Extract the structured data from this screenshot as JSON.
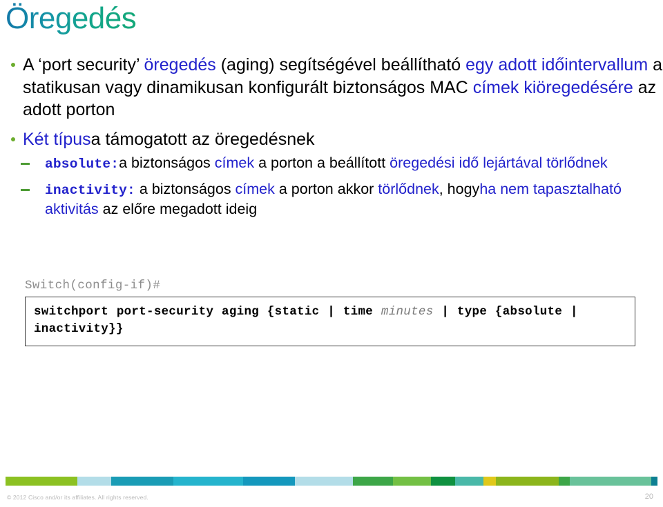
{
  "slide": {
    "title": "Öregedés",
    "page_number": "20",
    "title_gradient_from": "#1277a8",
    "title_gradient_to": "#14a878",
    "accent_blue": "#2222cc",
    "bullet_green": "#6cad2e",
    "dash_green": "#4e9c35"
  },
  "bullets": [
    {
      "level": 1,
      "runs": [
        {
          "text": "A ‘port security’ ",
          "style": "black"
        },
        {
          "text": "öregedés",
          "style": "blue"
        },
        {
          "text": " (aging) segítségével beállítható ",
          "style": "black"
        },
        {
          "text": "egy adott időintervallum",
          "style": "blue"
        },
        {
          "text": " a statikusan vagy dinamikusan konfigurált biztonságos MAC ",
          "style": "black"
        },
        {
          "text": "címek kiöregedésére",
          "style": "blue"
        },
        {
          "text": " az adott porton",
          "style": "black"
        }
      ]
    },
    {
      "level": 1,
      "runs": [
        {
          "text": "Két típus",
          "style": "blue"
        },
        {
          "text": "a támogatott az öregedésnek",
          "style": "black"
        }
      ]
    },
    {
      "level": 2,
      "runs": [
        {
          "text": "absolute:",
          "style": "mono"
        },
        {
          "text": "a biztonságos ",
          "style": "black"
        },
        {
          "text": "címek",
          "style": "blue"
        },
        {
          "text": " a porton a beállított ",
          "style": "black"
        },
        {
          "text": "öregedési idő lejártával törlődnek",
          "style": "blue"
        }
      ]
    },
    {
      "level": 2,
      "runs": [
        {
          "text": "inactivity:",
          "style": "mono"
        },
        {
          "text": " a biztonságos ",
          "style": "black"
        },
        {
          "text": "címek",
          "style": "blue"
        },
        {
          "text": " a porton akkor ",
          "style": "black"
        },
        {
          "text": "törlődnek",
          "style": "blue"
        },
        {
          "text": ", hogy",
          "style": "black"
        },
        {
          "text": "ha nem tapasztalható aktivitás",
          "style": "blue"
        },
        {
          "text": " az előre megadott ideig",
          "style": "black"
        }
      ]
    }
  ],
  "command": {
    "prompt": "Switch(config-if)#",
    "parts": [
      {
        "text": "switchport port-security aging {static | time ",
        "style": "bold"
      },
      {
        "text": "minutes",
        "style": "italic-var"
      },
      {
        "text": " | type {absolute | inactivity}}",
        "style": "bold"
      }
    ],
    "full_text": "switchport port-security aging {static | time minutes | type {absolute | inactivity}}"
  },
  "footer": {
    "copyright": "© 2012 Cisco and/or its affiliates. All rights reserved.",
    "bar_segments": [
      {
        "color": "#8cc122",
        "width": 13.2
      },
      {
        "color": "#b3dde8",
        "width": 6.3
      },
      {
        "color": "#1a9cb5",
        "width": 11.4
      },
      {
        "color": "#25b4cd",
        "width": 12.8
      },
      {
        "color": "#1498bd",
        "width": 9.6
      },
      {
        "color": "#b3dde8",
        "width": 10.6
      },
      {
        "color": "#3da648",
        "width": 7.4
      },
      {
        "color": "#73c044",
        "width": 7.0
      },
      {
        "color": "#0f9140",
        "width": 4.5
      },
      {
        "color": "#49b8a8",
        "width": 5.2
      },
      {
        "color": "#e0c81a",
        "width": 2.2
      },
      {
        "color": "#8cb51c",
        "width": 11.6
      },
      {
        "color": "#3da648",
        "width": 2.0
      },
      {
        "color": "#69c29a",
        "width": 15.0
      },
      {
        "color": "#0d7f92",
        "width": 1.2
      }
    ]
  }
}
